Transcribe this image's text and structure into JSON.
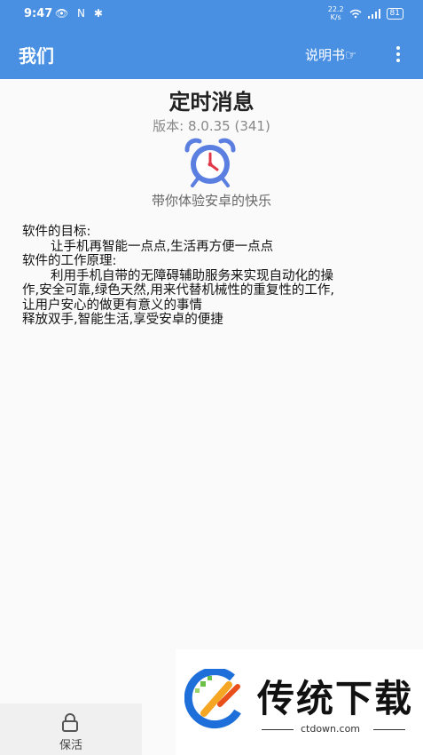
{
  "status_bar": {
    "time": "9:47",
    "left_icons": "👁 N ✱",
    "speed_value": "22.2",
    "speed_unit": "K/s",
    "battery": "81"
  },
  "app_bar": {
    "title": "我们",
    "manual_label": "说明书☞"
  },
  "main": {
    "title": "定时消息",
    "version": "版本: 8.0.35 (341)",
    "slogan": "带你体验安卓的快乐",
    "description": [
      {
        "text": "软件的目标:",
        "indent": false
      },
      {
        "text": "让手机再智能一点点,生活再方便一点点",
        "indent": true
      },
      {
        "text": "软件的工作原理:",
        "indent": false
      },
      {
        "text": "利用手机自带的无障碍辅助服务来实现自动化的操",
        "indent": true
      },
      {
        "text": "作,安全可靠,绿色天然,用来代替机械性的重复性的工作,",
        "indent": false
      },
      {
        "text": "让用户安心的做更有意义的事情",
        "indent": false
      },
      {
        "text": "释放双手,智能生活,享受安卓的便捷",
        "indent": false
      }
    ]
  },
  "bottom_nav": {
    "keep_alive_label": "保活",
    "icon": "lock-icon"
  },
  "watermark": {
    "brand": "传统下载",
    "url": "ctdown.com"
  },
  "colors": {
    "primary": "#4a90e2",
    "clock_blue": "#5b7fe0",
    "clock_hand": "#e2394a"
  }
}
